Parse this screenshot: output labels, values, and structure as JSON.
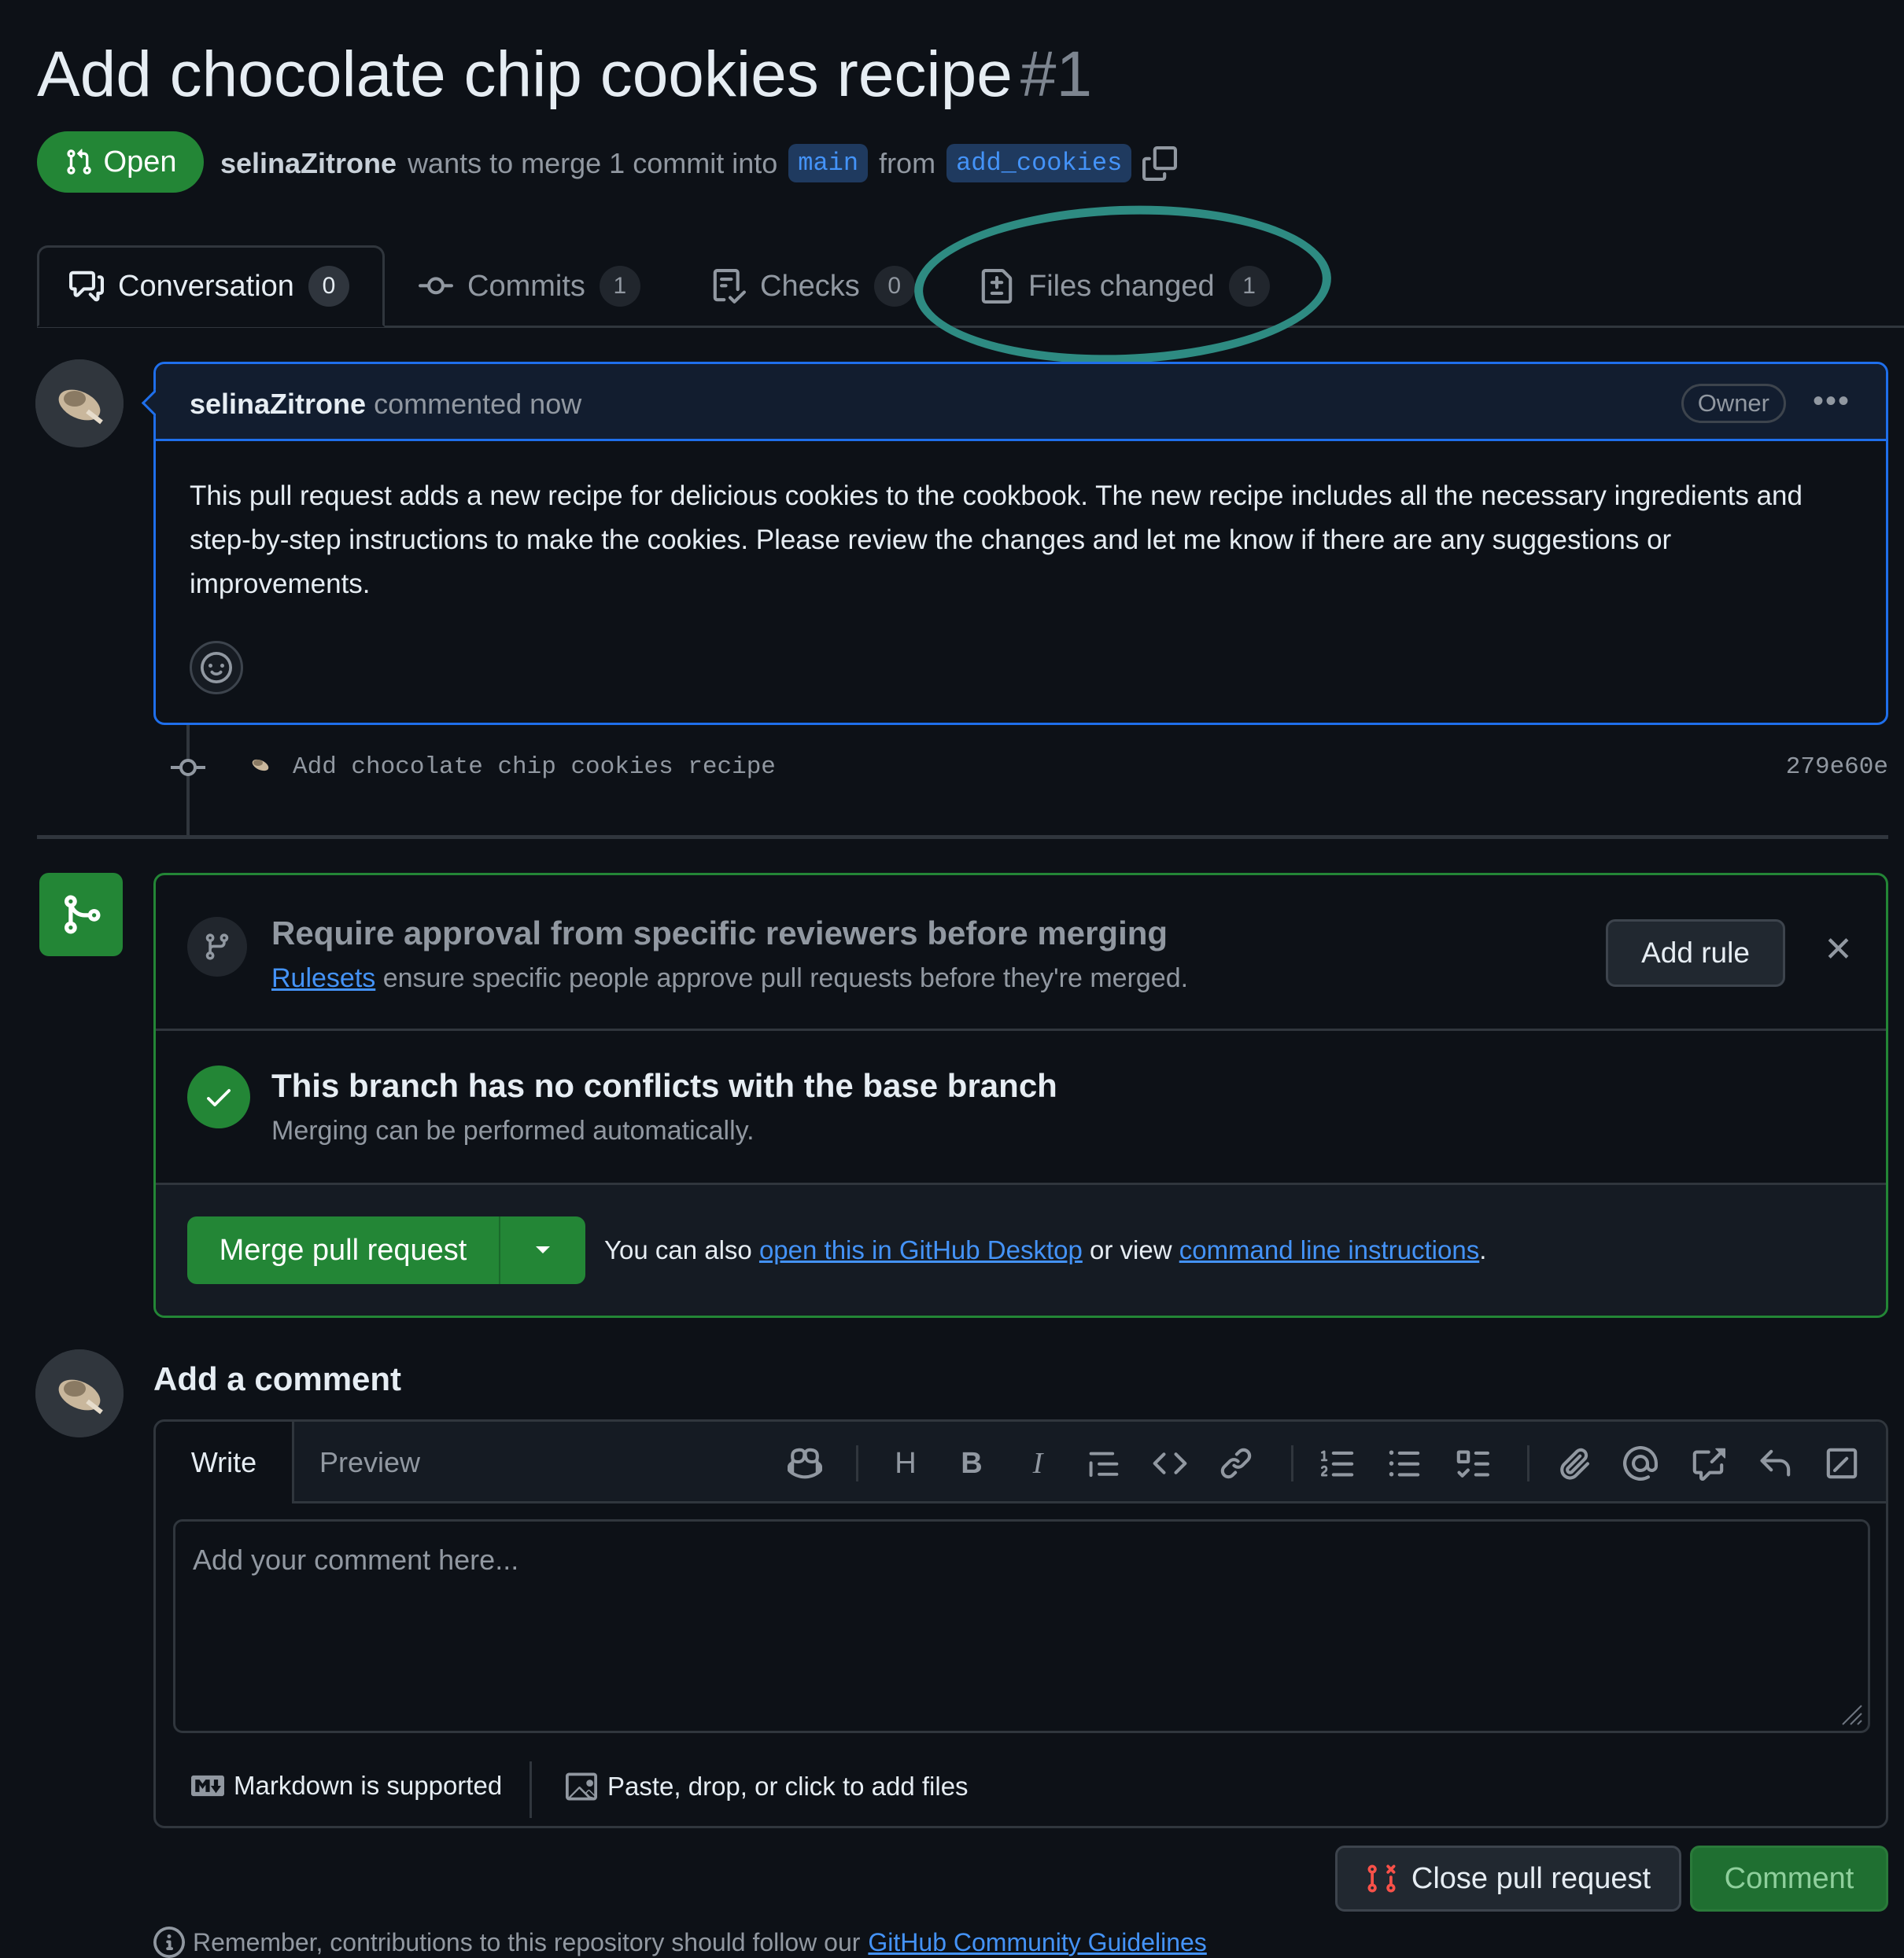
{
  "pr": {
    "title": "Add chocolate chip cookies recipe",
    "number": "#1",
    "state": "Open",
    "author": "selinaZitrone",
    "merge_text_1": "wants to merge 1 commit into",
    "base_branch": "main",
    "merge_text_2": "from",
    "head_branch": "add_cookies"
  },
  "tabs": [
    {
      "label": "Conversation",
      "count": "0"
    },
    {
      "label": "Commits",
      "count": "1"
    },
    {
      "label": "Checks",
      "count": "0"
    },
    {
      "label": "Files changed",
      "count": "1"
    }
  ],
  "comment": {
    "author": "selinaZitrone",
    "action": "commented now",
    "badge": "Owner",
    "body": "This pull request adds a new recipe for delicious cookies to the cookbook. The new recipe includes all the necessary ingredients and step-by-step instructions to make the cookies. Please review the changes and let me know if there are any suggestions or improvements."
  },
  "commit": {
    "message": "Add chocolate chip cookies recipe",
    "sha": "279e60e"
  },
  "ruleset": {
    "title": "Require approval from specific reviewers before merging",
    "link": "Rulesets",
    "desc": "ensure specific people approve pull requests before they're merged.",
    "button": "Add rule"
  },
  "conflicts": {
    "title": "This branch has no conflicts with the base branch",
    "desc": "Merging can be performed automatically."
  },
  "merge": {
    "button": "Merge pull request",
    "also_prefix": "You can also",
    "desktop_link": "open this in GitHub Desktop",
    "or_view": "or view",
    "cli_link": "command line instructions",
    "period": "."
  },
  "add_comment": {
    "title": "Add a comment",
    "tab_write": "Write",
    "tab_preview": "Preview",
    "placeholder": "Add your comment here...",
    "markdown_note": "Markdown is supported",
    "files_note": "Paste, drop, or click to add files"
  },
  "actions": {
    "close": "Close pull request",
    "comment": "Comment"
  },
  "guidelines": {
    "prefix": "Remember, contributions to this repository should follow our",
    "link": "GitHub Community Guidelines"
  },
  "colors": {
    "open_green": "#238636",
    "link_blue": "#4493f8",
    "highlight_ellipse": "#2e8b82",
    "comment_border": "#1f6feb"
  },
  "icons": {
    "state": "git-pull-request-icon",
    "copy": "copy-icon",
    "close_pr": "git-pull-request-closed-icon"
  }
}
